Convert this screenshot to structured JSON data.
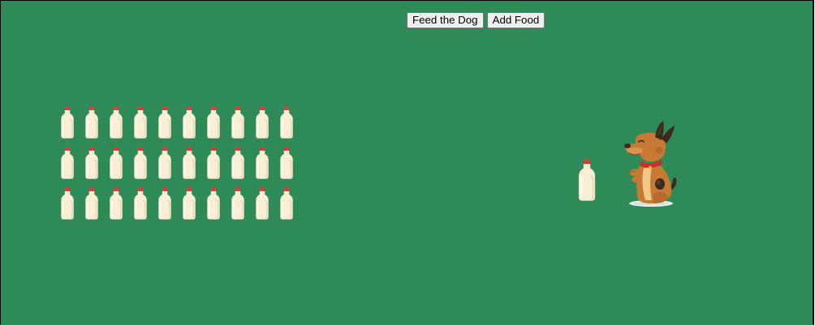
{
  "controls": {
    "feed_label": "Feed the Dog",
    "add_label": "Add Food"
  },
  "milk_stock": {
    "count": 30,
    "icon": "milk-bottle-icon"
  },
  "serving": {
    "count": 1,
    "icon": "milk-bottle-icon"
  },
  "dog": {
    "icon": "dog-icon"
  },
  "colors": {
    "background": "#2e8b57",
    "bottle_body": "#f8efd6",
    "bottle_cap": "#e03a3a",
    "dog_fur": "#c87a35",
    "collar": "#d42a2a"
  }
}
